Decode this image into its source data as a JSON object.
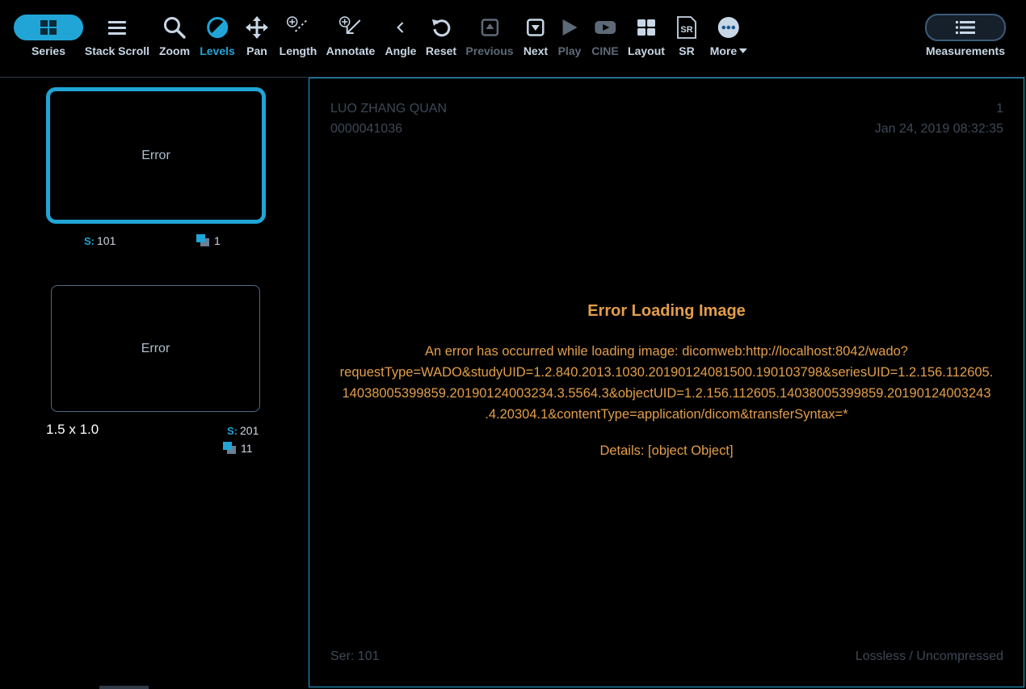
{
  "toolbar": {
    "series_label": "Series",
    "tools": [
      {
        "label": "Stack Scroll",
        "icon": "stack-scroll-icon"
      },
      {
        "label": "Zoom",
        "icon": "zoom-icon"
      },
      {
        "label": "Levels",
        "icon": "levels-icon"
      },
      {
        "label": "Pan",
        "icon": "pan-icon"
      },
      {
        "label": "Length",
        "icon": "length-icon"
      },
      {
        "label": "Annotate",
        "icon": "annotate-icon"
      },
      {
        "label": "Angle",
        "icon": "angle-icon"
      },
      {
        "label": "Reset",
        "icon": "reset-icon"
      },
      {
        "label": "Previous",
        "icon": "previous-icon"
      },
      {
        "label": "Next",
        "icon": "next-icon"
      },
      {
        "label": "Play",
        "icon": "play-icon"
      },
      {
        "label": "CINE",
        "icon": "cine-icon"
      },
      {
        "label": "Layout",
        "icon": "layout-icon"
      },
      {
        "label": "SR",
        "icon": "sr-icon"
      },
      {
        "label": "More",
        "icon": "more-icon"
      }
    ],
    "active_tool": "Levels",
    "disabled_tools": [
      "Previous",
      "Play",
      "CINE"
    ],
    "measurements_label": "Measurements",
    "sr_icon_text": "SR"
  },
  "series_panel": {
    "thumbnails": [
      {
        "text": "Error",
        "series_prefix": "S:",
        "series_number": "101",
        "instances": "1",
        "active": true
      },
      {
        "text": "Error",
        "series_prefix": "S:",
        "series_number": "201",
        "instances": "11",
        "description": "1.5 x 1.0",
        "active": false
      }
    ]
  },
  "viewport": {
    "patient_name": "LUO ZHANG QUAN",
    "patient_id": "0000041036",
    "instance_number": "1",
    "study_datetime": "Jan 24, 2019 08:32:35",
    "series_label": "Ser: 101",
    "compression": "Lossless / Uncompressed",
    "error": {
      "title": "Error Loading Image",
      "message_lines": [
        "An error has occurred while loading image: dicomweb:http://localhost:8042/wado?",
        "requestType=WADO&studyUID=1.2.840.2013.1030.20190124081500.190103798&seriesUID=1.2.156.112605.",
        "14038005399859.20190124003234.3.5564.3&objectUID=1.2.156.112605.14038005399859.20190124003243",
        ".4.20304.1&contentType=application/dicom&transferSyntax=*"
      ],
      "details": "Details: [object Object]"
    }
  },
  "colors": {
    "accent": "#20a5d6",
    "error_text": "#e29e4a",
    "overlay_text": "#3d4957",
    "background": "#000000"
  }
}
